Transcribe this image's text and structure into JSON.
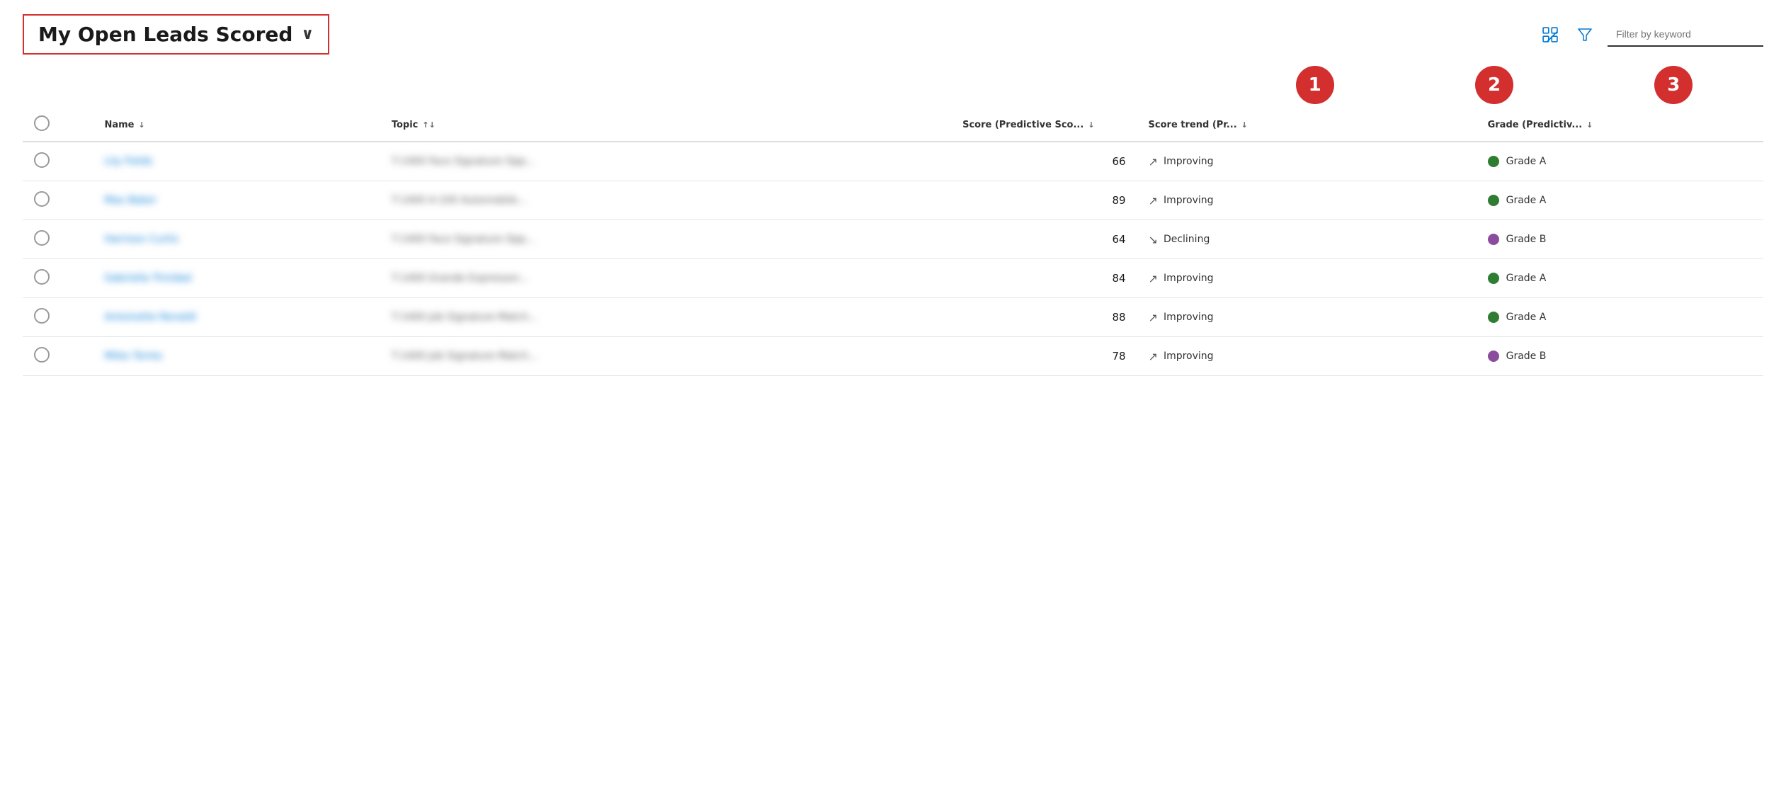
{
  "header": {
    "title": "My Open Leads Scored",
    "chevron": "∨",
    "filter_placeholder": "Filter by keyword",
    "badges": [
      {
        "number": "1"
      },
      {
        "number": "2"
      },
      {
        "number": "3"
      }
    ]
  },
  "table": {
    "columns": [
      {
        "id": "checkbox",
        "label": ""
      },
      {
        "id": "name",
        "label": "Name",
        "sort": "↓"
      },
      {
        "id": "topic",
        "label": "Topic",
        "sort": "↑↓"
      },
      {
        "id": "score",
        "label": "Score (Predictive Sco...",
        "sort": "↓"
      },
      {
        "id": "trend",
        "label": "Score trend (Pr...",
        "sort": "↓"
      },
      {
        "id": "grade",
        "label": "Grade (Predictiv...",
        "sort": "↓"
      }
    ],
    "rows": [
      {
        "name": "Lily Fields",
        "topic": "T-1400 Face Signature Opp...",
        "score": 66,
        "trend_arrow": "↗",
        "trend_label": "Improving",
        "grade_color": "#2e7d32",
        "grade_label": "Grade A"
      },
      {
        "name": "Max Baker",
        "topic": "T-1400 A-100 Automobile...",
        "score": 89,
        "trend_arrow": "↗",
        "trend_label": "Improving",
        "grade_color": "#2e7d32",
        "grade_label": "Grade A"
      },
      {
        "name": "Harrison Curtis",
        "topic": "T-1400 Face Signature Opp...",
        "score": 64,
        "trend_arrow": "↘",
        "trend_label": "Declining",
        "grade_color": "#8b4c9e",
        "grade_label": "Grade B"
      },
      {
        "name": "Gabriella Trinidad",
        "topic": "T-1400 Grande Expresson...",
        "score": 84,
        "trend_arrow": "↗",
        "trend_label": "Improving",
        "grade_color": "#2e7d32",
        "grade_label": "Grade A"
      },
      {
        "name": "Antoinette Renaldi",
        "topic": "T-1400 Job Signature Match...",
        "score": 88,
        "trend_arrow": "↗",
        "trend_label": "Improving",
        "grade_color": "#2e7d32",
        "grade_label": "Grade A"
      },
      {
        "name": "Miles Torres",
        "topic": "T-1400 Job Signature Match...",
        "score": 78,
        "trend_arrow": "↗",
        "trend_label": "Improving",
        "grade_color": "#8b4c9e",
        "grade_label": "Grade B"
      }
    ]
  }
}
